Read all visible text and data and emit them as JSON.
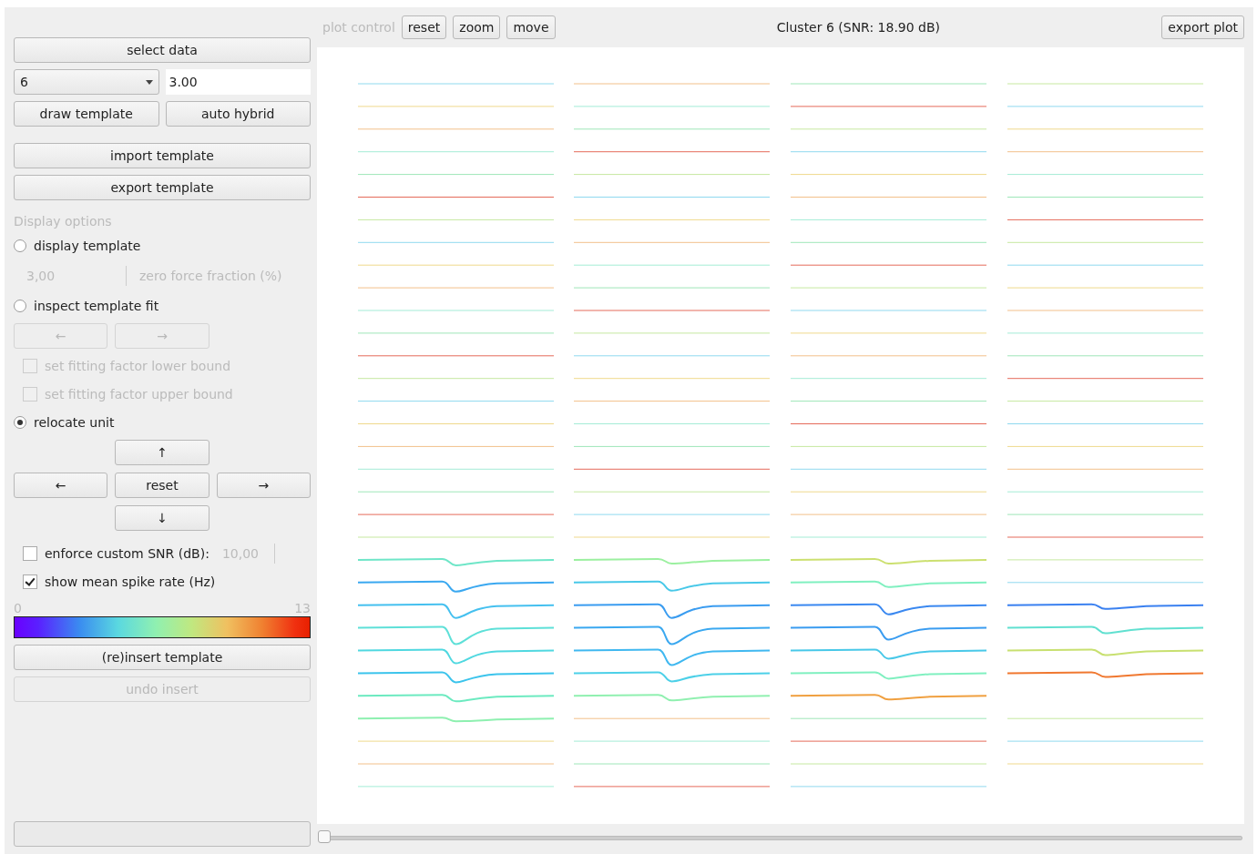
{
  "left_panel": {
    "select_button": "select data",
    "cluster_dropdown": {
      "value": "6"
    },
    "threshold_field": {
      "value": "3.00"
    },
    "template_buttons": [
      "draw template",
      "auto hybrid"
    ],
    "import_button": "import template",
    "export_button": "export template",
    "section_title": "Display options",
    "display_template": {
      "label": "display template",
      "selected": false
    },
    "zero_force": {
      "value": "3,00",
      "label": "zero force fraction (%)",
      "disabled": true
    },
    "inspect_fit": {
      "label": "inspect template fit",
      "selected": false
    },
    "fit_nav": [
      {
        "label": "←",
        "disabled": true
      },
      {
        "label": "→",
        "disabled": true
      }
    ],
    "bound_checks": [
      {
        "label": "set fitting factor lower bound",
        "checked": false,
        "disabled": true
      },
      {
        "label": "set fitting factor upper bound",
        "checked": false,
        "disabled": true
      }
    ],
    "relocate_unit": {
      "label": "relocate unit",
      "selected": true
    },
    "move_pad": {
      "up": "↑",
      "left": "←",
      "reset": "reset",
      "right": "→",
      "down": "↓"
    },
    "custom_snr": {
      "label": "enforce custom SNR (dB):",
      "checked": false,
      "value": "10,00"
    },
    "spike_rate": {
      "label": "show mean spike rate (Hz)",
      "checked": true
    },
    "colorbar": {
      "min": "0",
      "max": "13"
    },
    "reinsert_button": {
      "label": "(re)insert template",
      "disabled": false
    },
    "undo_button": {
      "label": "undo insert",
      "disabled": true
    }
  },
  "plot_toolbar": {
    "label": "plot control",
    "buttons": [
      "reset",
      "zoom",
      "move"
    ],
    "title": "Cluster 6 (SNR: 18.90 dB)",
    "export_button": "export plot"
  },
  "time_slider": {
    "level": 0
  }
}
